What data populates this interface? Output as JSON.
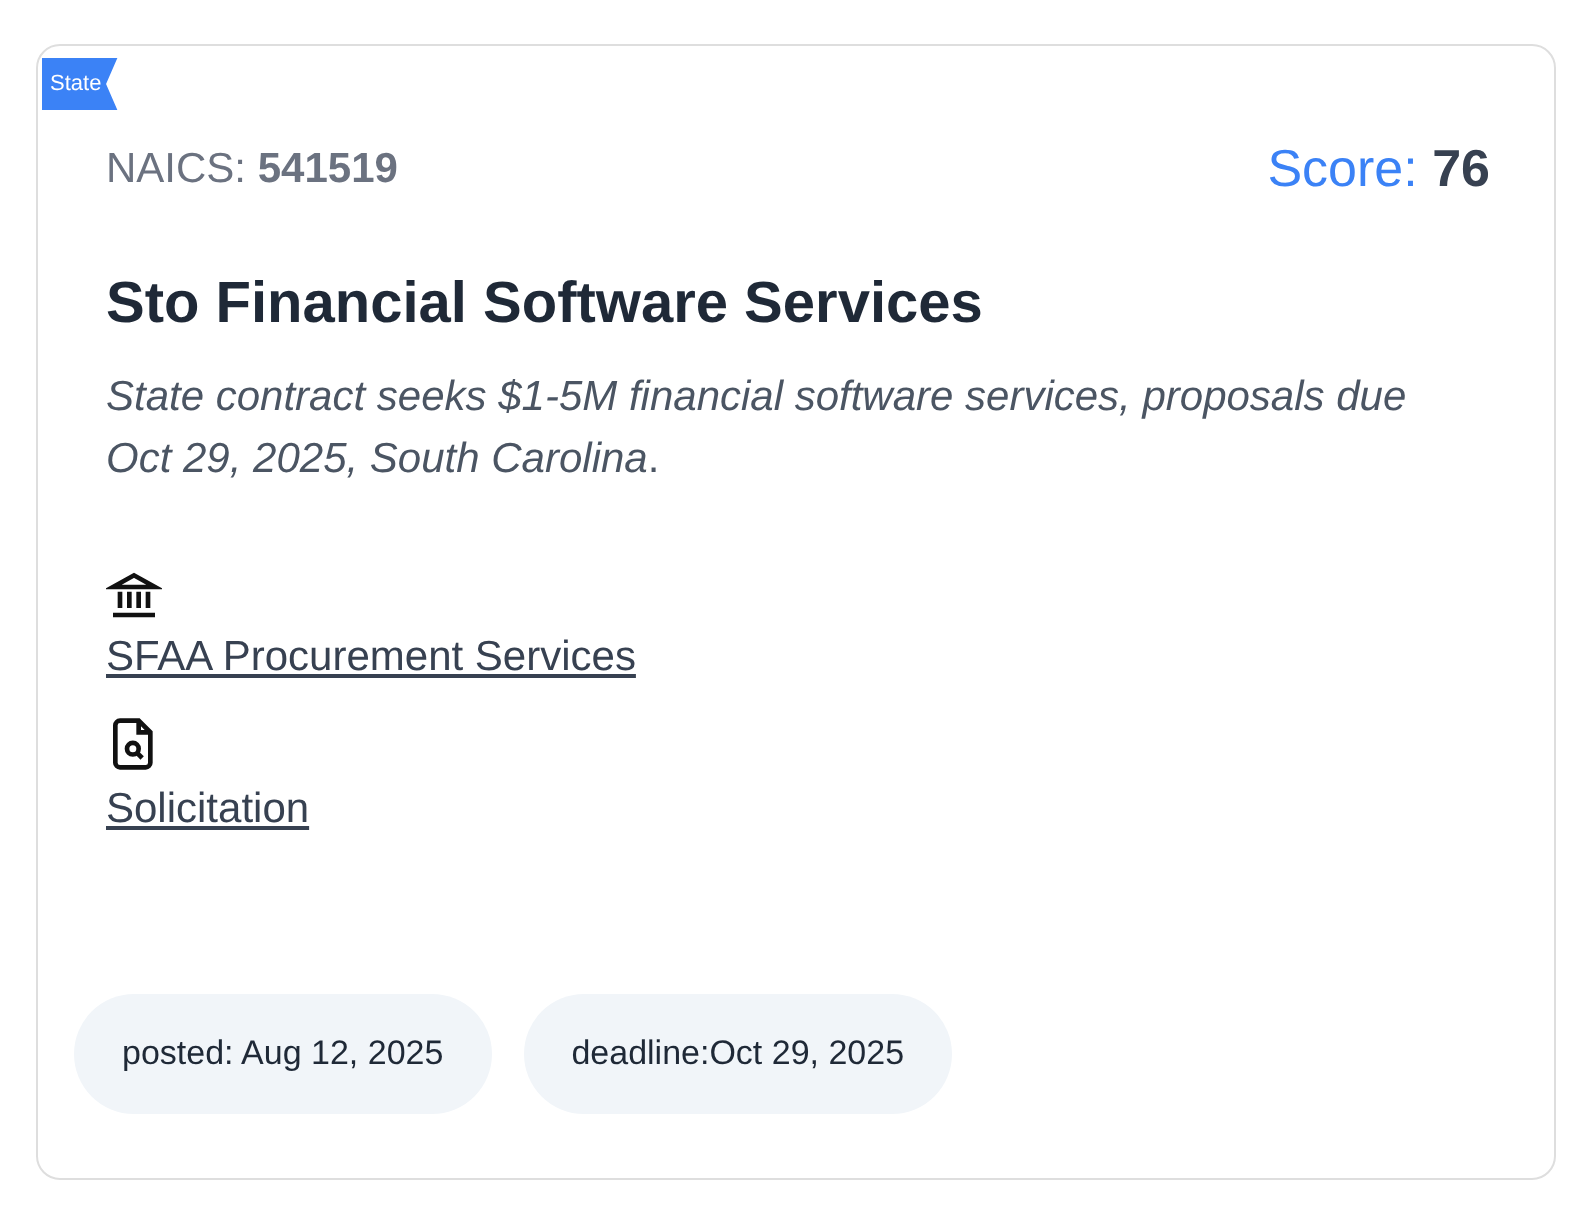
{
  "ribbon": "State",
  "naics": {
    "label": "NAICS:",
    "value": "541519"
  },
  "score": {
    "label": "Score:",
    "value": "76"
  },
  "title": "Sto Financial Software Services",
  "description": "*State contract seeks $1-5M financial software services, proposals due Oct 29, 2025, South Carolina*.",
  "links": [
    {
      "kind": "agency",
      "label": "SFAA Procurement Services"
    },
    {
      "kind": "document",
      "label": "Solicitation"
    }
  ],
  "chips": [
    "posted: Aug 12, 2025",
    "deadline:Oct 29, 2025"
  ]
}
